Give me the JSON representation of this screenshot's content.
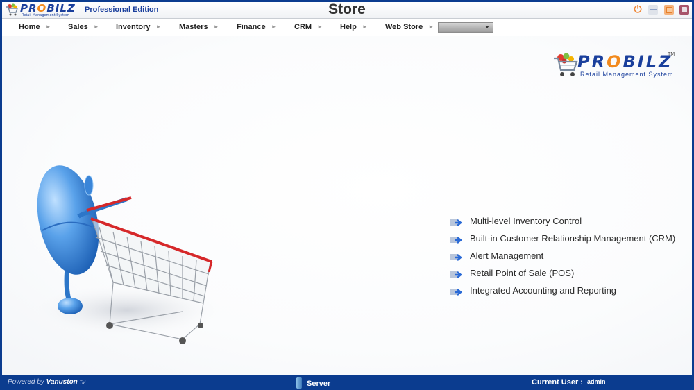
{
  "titlebar": {
    "logo_word": [
      "PR",
      "O",
      "BILZ"
    ],
    "logo_subtitle": "Retail Management System",
    "edition": "Professional Edition",
    "title": "Store",
    "controls": [
      "power-icon",
      "minimize-icon",
      "maximize-icon",
      "close-icon"
    ]
  },
  "menu": {
    "items": [
      {
        "label": "Home"
      },
      {
        "label": "Sales"
      },
      {
        "label": "Inventory"
      },
      {
        "label": "Masters"
      },
      {
        "label": "Finance"
      },
      {
        "label": "CRM"
      },
      {
        "label": "Help"
      },
      {
        "label": "Web Store"
      }
    ],
    "submenu_arrow": "►",
    "dropdown_value": ""
  },
  "main": {
    "logo": {
      "word": [
        "PR",
        "O",
        "BILZ"
      ],
      "tm": "TM",
      "subtitle": "Retail Management System"
    },
    "illustration": "mouse-pushing-shopping-cart",
    "features": [
      {
        "label": "Multi-level Inventory Control",
        "icon": "arrow-cart-icon"
      },
      {
        "label": "Built-in Customer Relationship Management (CRM)",
        "icon": "arrow-cart-icon"
      },
      {
        "label": "Alert Management",
        "icon": "arrow-cart-icon"
      },
      {
        "label": "Retail Point of Sale (POS)",
        "icon": "arrow-cart-icon"
      },
      {
        "label": "Integrated Accounting and Reporting",
        "icon": "arrow-cart-icon"
      }
    ]
  },
  "statusbar": {
    "powered_prefix": "Powered by",
    "powered_brand": "Vanuston",
    "powered_tm": "TM",
    "server_label": "Server",
    "current_user_label": "Current User :",
    "current_user": "admin"
  },
  "colors": {
    "frame_blue": "#0b3c8f",
    "brand_blue": "#1a3f9c",
    "brand_orange": "#f28a1d"
  }
}
